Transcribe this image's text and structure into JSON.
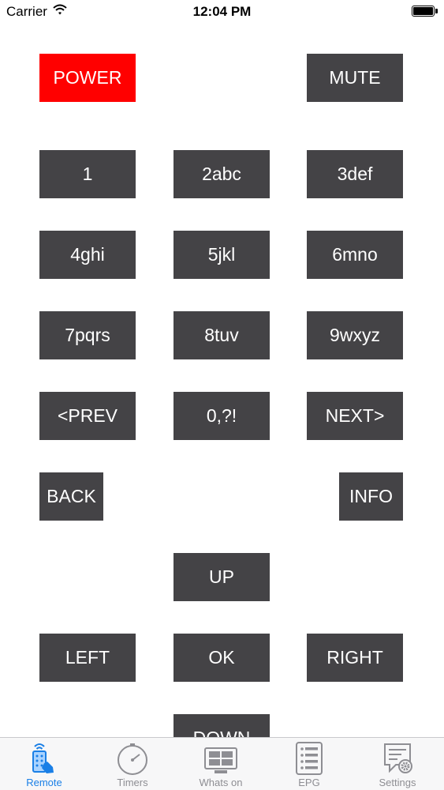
{
  "status_bar": {
    "carrier": "Carrier",
    "time": "12:04 PM"
  },
  "remote": {
    "power": "POWER",
    "mute": "MUTE",
    "keys": [
      "1",
      "2abc",
      "3def",
      "4ghi",
      "5jkl",
      "6mno",
      "7pqrs",
      "8tuv",
      "9wxyz"
    ],
    "prev": "<PREV",
    "zero": "0,?!",
    "next": "NEXT>",
    "back": "BACK",
    "info": "INFO",
    "up": "UP",
    "left": "LEFT",
    "ok": "OK",
    "right": "RIGHT",
    "down": "DOWN"
  },
  "colors": {
    "button": "#444346",
    "power": "#ff0000",
    "active_tab": "#1a7fe6",
    "inactive_tab": "#8e8e93"
  },
  "tabs": [
    {
      "label": "Remote",
      "icon": "remote-icon",
      "active": true
    },
    {
      "label": "Timers",
      "icon": "timer-icon",
      "active": false
    },
    {
      "label": "Whats on",
      "icon": "tv-icon",
      "active": false
    },
    {
      "label": "EPG",
      "icon": "list-icon",
      "active": false
    },
    {
      "label": "Settings",
      "icon": "settings-icon",
      "active": false
    }
  ]
}
